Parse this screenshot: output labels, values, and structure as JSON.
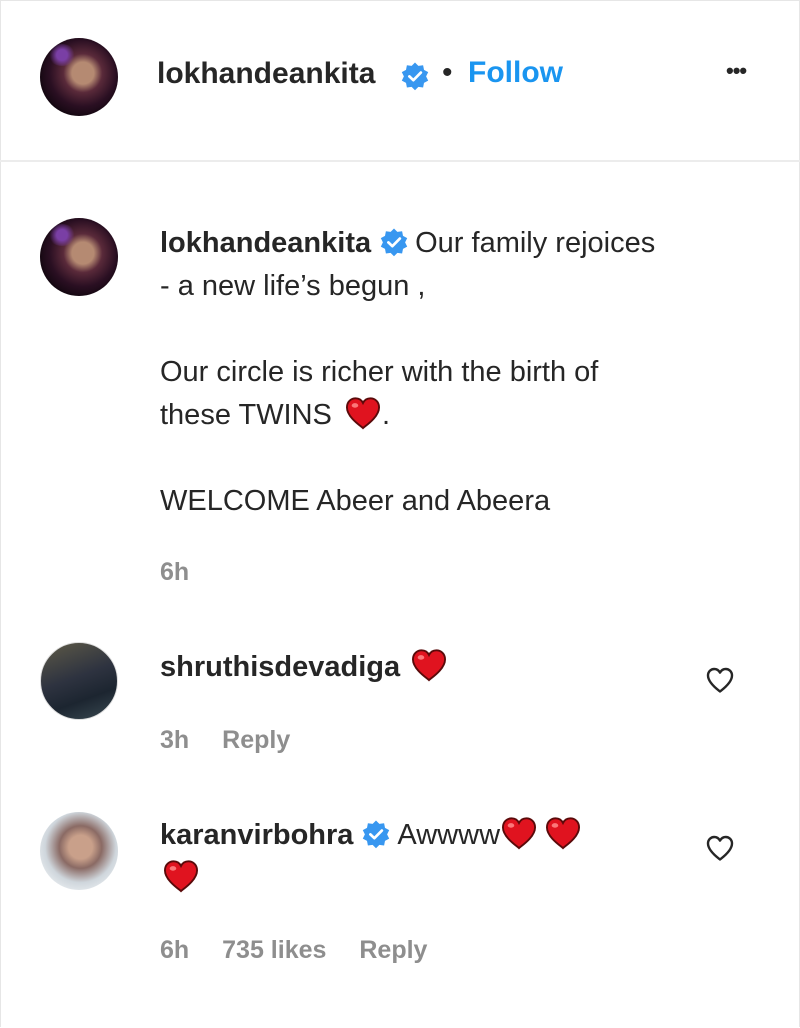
{
  "header": {
    "username": "lokhandeankita",
    "separator": "•",
    "follow_label": "Follow",
    "more_label": "•••"
  },
  "post": {
    "username": "lokhandeankita",
    "caption_line1": "Our family rejoices",
    "caption_line2": "- a new life’s begun ,",
    "caption_line3": "Our circle is richer with the birth of",
    "caption_line4": "these TWINS",
    "caption_line4_end": ".",
    "caption_line5": "WELCOME Abeer and Abeera",
    "time": "6h"
  },
  "comments": [
    {
      "username": "shruthisdevadiga",
      "time": "3h",
      "reply_label": "Reply"
    },
    {
      "username": "karanvirbohra",
      "text": "Awwww",
      "time": "6h",
      "likes": "735 likes",
      "reply_label": "Reply"
    }
  ],
  "colors": {
    "follow_blue": "#1a95f0",
    "verified_blue": "#3897f0",
    "heart_red": "#e0131f",
    "meta_gray": "#8e8e8e"
  },
  "icons": {
    "verified": "verified-badge-icon",
    "heart": "red-heart-emoji",
    "like": "heart-outline-icon",
    "more": "more-options-icon"
  }
}
